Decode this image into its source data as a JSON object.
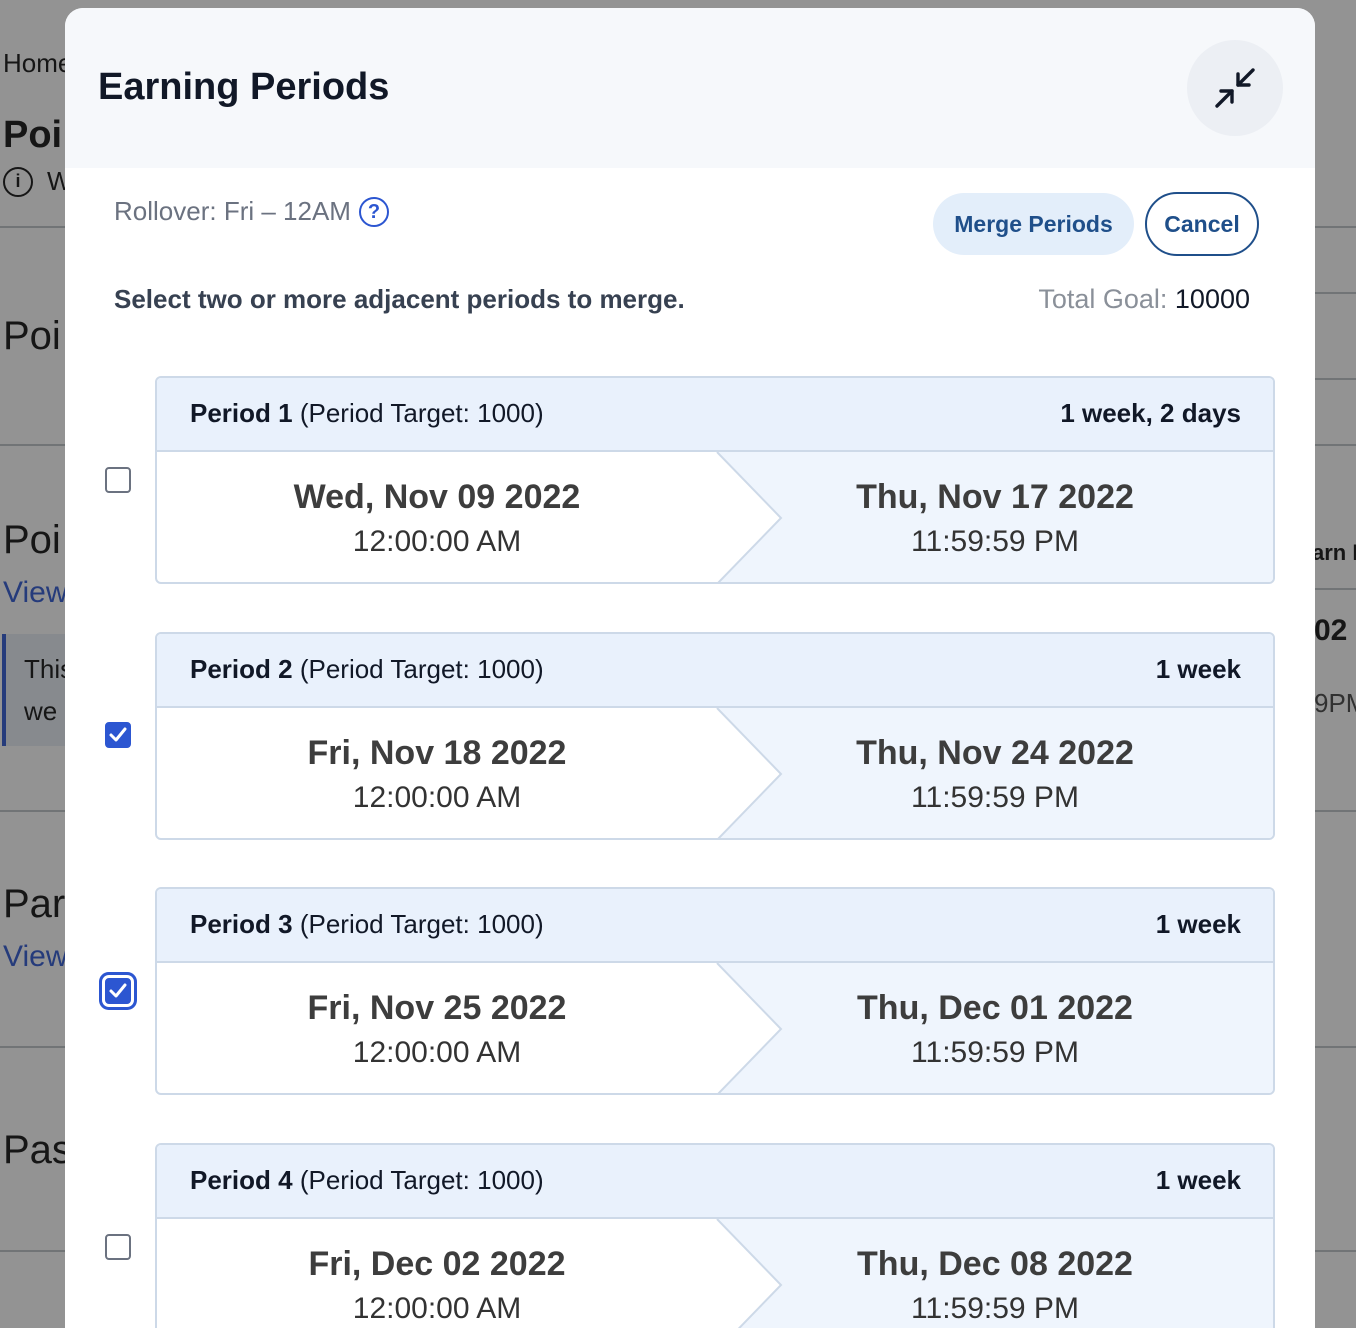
{
  "background": {
    "breadcrumb": "Home",
    "heading_1": "Poi",
    "info_text": "W",
    "heading_2": "Poi",
    "heading_3": "Poi",
    "link_1": "View",
    "note_line_1": "This",
    "note_line_2": "we",
    "heading_4": "Par",
    "link_2": "View",
    "heading_5": "Pas",
    "right_fragment_1": "arn F",
    "right_fragment_2": "02",
    "right_fragment_3": "9PM"
  },
  "modal": {
    "title": "Earning Periods",
    "collapse_icon": "collapse-arrows-icon",
    "rollover": "Rollover: Fri – 12AM",
    "help_icon_glyph": "?",
    "merge_button": "Merge Periods",
    "cancel_button": "Cancel",
    "instruction": "Select two or more adjacent periods to merge.",
    "total_goal_label": "Total Goal:",
    "total_goal_value": "10000"
  },
  "periods": [
    {
      "name": "Period 1",
      "target": "(Period Target: 1000)",
      "duration": "1 week, 2 days",
      "start_date": "Wed, Nov 09 2022",
      "start_time": "12:00:00 AM",
      "end_date": "Thu, Nov 17 2022",
      "end_time": "11:59:59 PM",
      "checked": false,
      "focused": false
    },
    {
      "name": "Period 2",
      "target": "(Period Target: 1000)",
      "duration": "1 week",
      "start_date": "Fri, Nov 18 2022",
      "start_time": "12:00:00 AM",
      "end_date": "Thu, Nov 24 2022",
      "end_time": "11:59:59 PM",
      "checked": true,
      "focused": false
    },
    {
      "name": "Period 3",
      "target": "(Period Target: 1000)",
      "duration": "1 week",
      "start_date": "Fri, Nov 25 2022",
      "start_time": "12:00:00 AM",
      "end_date": "Thu, Dec 01 2022",
      "end_time": "11:59:59 PM",
      "checked": true,
      "focused": true
    },
    {
      "name": "Period 4",
      "target": "(Period Target: 1000)",
      "duration": "1 week",
      "start_date": "Fri, Dec 02 2022",
      "start_time": "12:00:00 AM",
      "end_date": "Thu, Dec 08 2022",
      "end_time": "11:59:59 PM",
      "checked": false,
      "focused": false
    }
  ],
  "colors": {
    "accent": "#2c56d1",
    "card_header_bg": "#e9f1fc",
    "merge_button_bg": "#e3eefa",
    "button_text": "#1f4f8a"
  }
}
